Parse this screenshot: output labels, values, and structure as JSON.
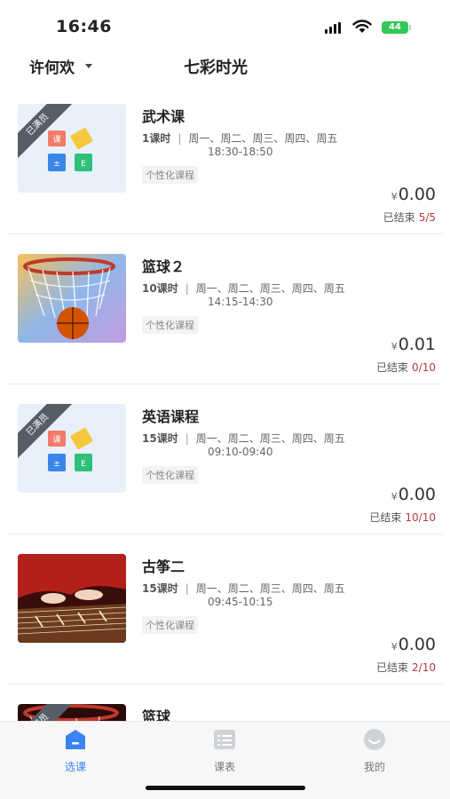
{
  "status_bar": {
    "time": "16:46",
    "battery": "44"
  },
  "header": {
    "user": "许何欢",
    "title": "七彩时光"
  },
  "courses": [
    {
      "name": "武术课",
      "hours": "1课时",
      "days": "周一、周二、周三、周四、周五",
      "time": "18:30-18:50",
      "tag": "个性化课程",
      "yen": "¥",
      "price": "0.00",
      "status": "已结束",
      "count": "5/5",
      "badge": "已满员",
      "thumb_icon": "school-books-icon"
    },
    {
      "name": "篮球２",
      "hours": "10课时",
      "days": "周一、周二、周三、周四、周五",
      "time": "14:15-14:30",
      "tag": "个性化课程",
      "yen": "¥",
      "price": "0.01",
      "status": "已结束",
      "count": "0/10",
      "badge": "",
      "thumb_icon": "basketball-hoop-image"
    },
    {
      "name": "英语课程",
      "hours": "15课时",
      "days": "周一、周二、周三、周四、周五",
      "time": "09:10-09:40",
      "tag": "个性化课程",
      "yen": "¥",
      "price": "0.00",
      "status": "已结束",
      "count": "10/10",
      "badge": "已满员",
      "thumb_icon": "school-books-icon"
    },
    {
      "name": "古筝二",
      "hours": "15课时",
      "days": "周一、周二、周三、周四、周五",
      "time": "09:45-10:15",
      "tag": "个性化课程",
      "yen": "¥",
      "price": "0.00",
      "status": "已结束",
      "count": "2/10",
      "badge": "",
      "thumb_icon": "guzheng-image"
    },
    {
      "name": "篮球",
      "badge": "已满员",
      "thumb_icon": "basketball-hoop-image"
    }
  ],
  "tabs": [
    {
      "label": "选课",
      "icon": "course-select-icon",
      "active": true
    },
    {
      "label": "课表",
      "icon": "schedule-icon",
      "active": false
    },
    {
      "label": "我的",
      "icon": "profile-icon",
      "active": false
    }
  ],
  "colors": {
    "accent": "#3b82f6",
    "count_red": "#b23b3b",
    "battery_green": "#34c759"
  }
}
